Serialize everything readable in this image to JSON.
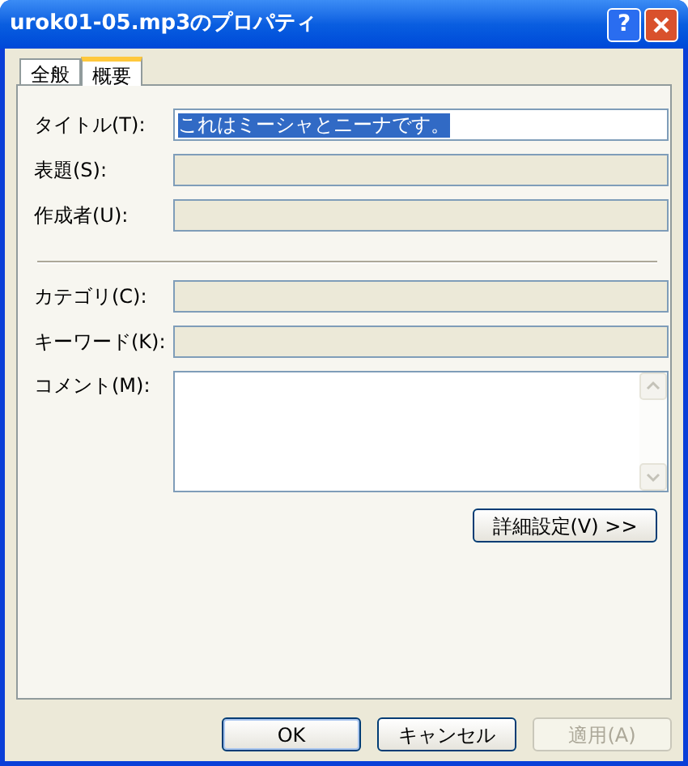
{
  "window": {
    "title": "urok01-05.mp3のプロパティ",
    "help_button": "?"
  },
  "tabs": [
    {
      "label": "全般",
      "selected": false
    },
    {
      "label": "概要",
      "selected": true
    }
  ],
  "fields": [
    {
      "kind": "text",
      "label": "タイトル(T):",
      "value": "これはミーシャとニーナです。",
      "selected": true,
      "disabled": false
    },
    {
      "kind": "text",
      "label": "表題(S):",
      "disabled": true
    },
    {
      "kind": "text",
      "label": "作成者(U):",
      "disabled": true
    },
    {
      "kind": "separator"
    },
    {
      "kind": "text",
      "label": "カテゴリ(C):",
      "disabled": true
    },
    {
      "kind": "text",
      "label": "キーワード(K):",
      "disabled": true
    },
    {
      "kind": "textarea",
      "label": "コメント(M):",
      "disabled": false
    }
  ],
  "advanced_button": {
    "label": "詳細設定(V) >>"
  },
  "buttons": [
    {
      "label": "OK",
      "disabled": false,
      "default": true
    },
    {
      "label": "キャンセル",
      "disabled": false,
      "default": false
    },
    {
      "label": "適用(A)",
      "disabled": true,
      "default": false
    }
  ]
}
